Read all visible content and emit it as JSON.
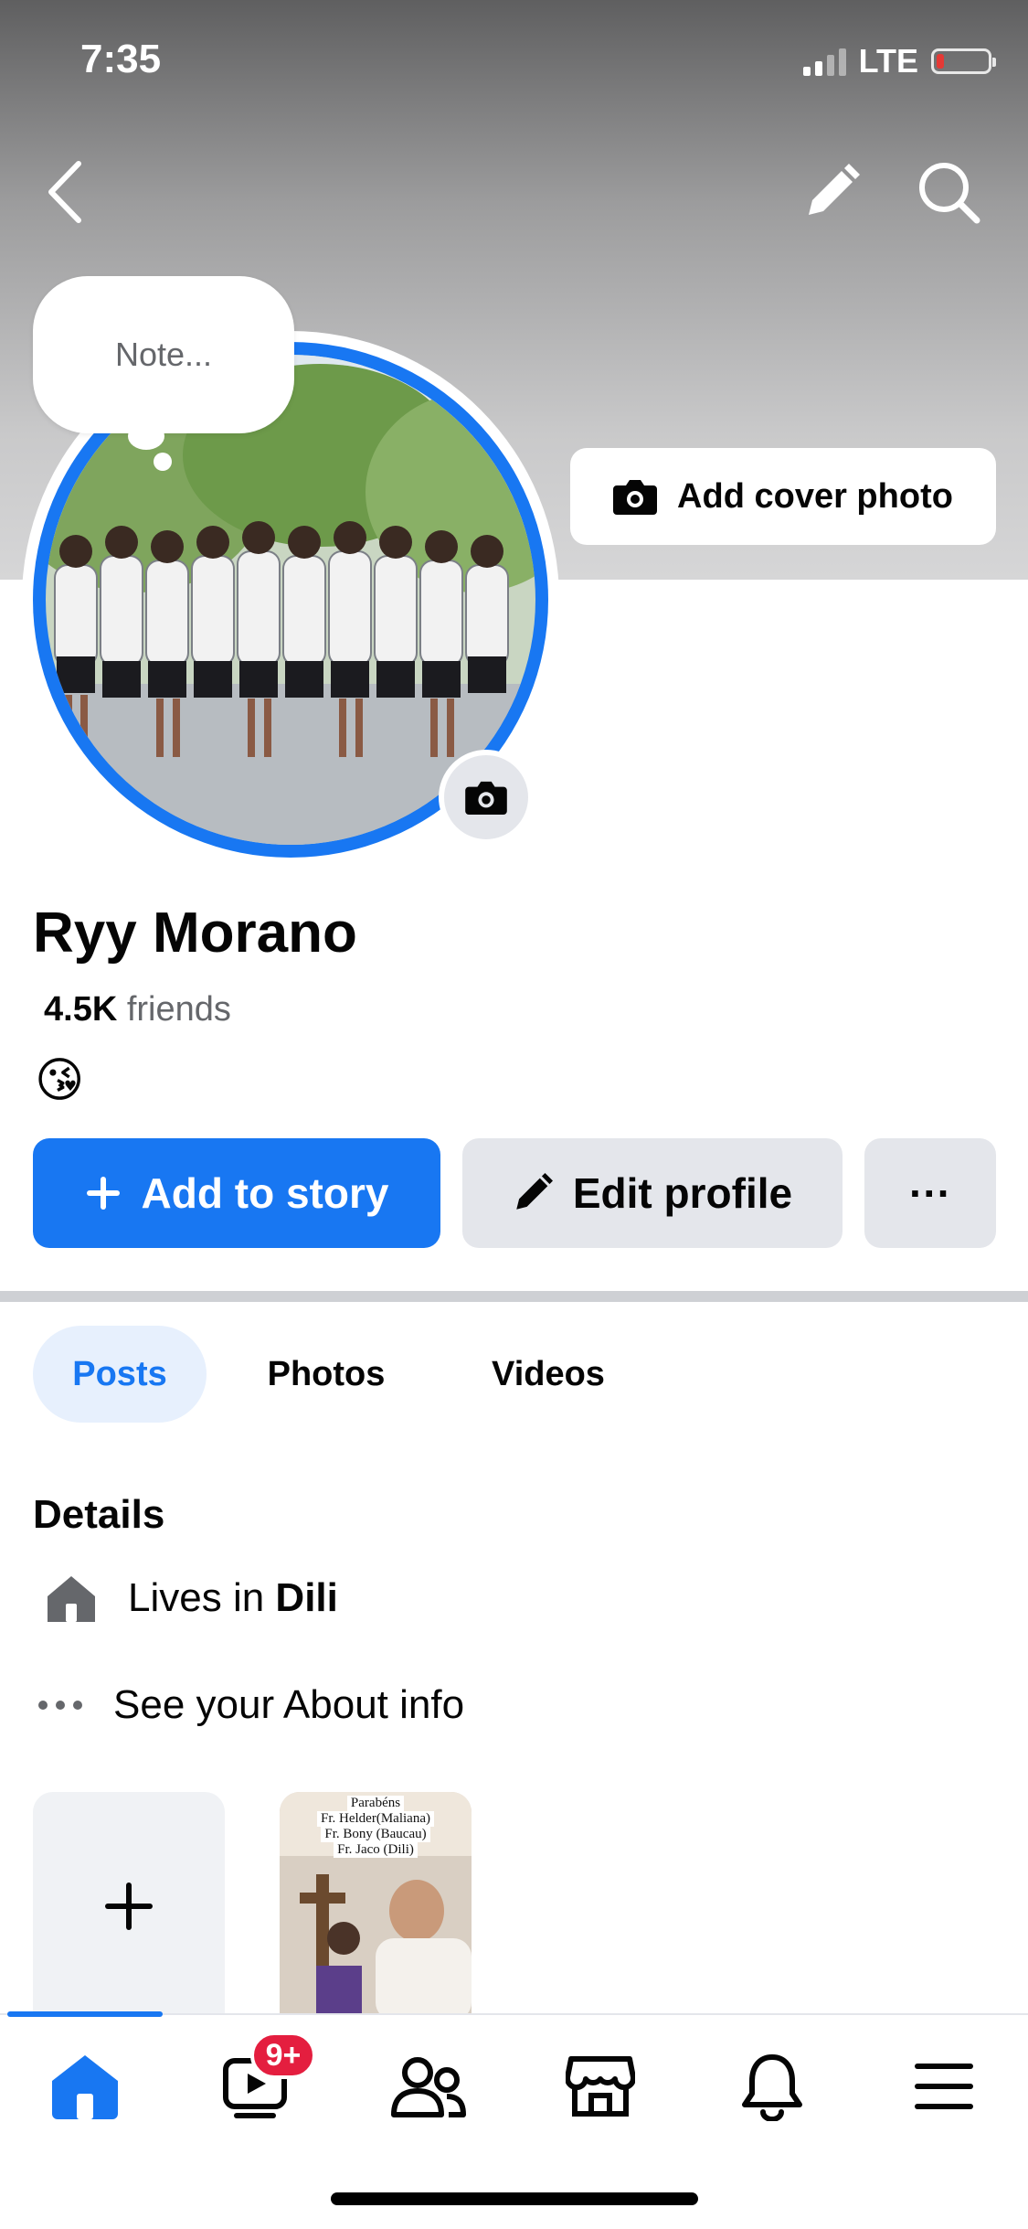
{
  "status_bar": {
    "time": "7:35",
    "network": "LTE",
    "signal_bars": 2,
    "battery_level": 0.1
  },
  "header": {
    "back_icon": "chevron-left-icon",
    "edit_icon": "pencil-icon",
    "search_icon": "search-icon"
  },
  "note_bubble": {
    "text": "Note..."
  },
  "cover": {
    "add_cover_label": "Add cover photo"
  },
  "profile": {
    "name": "Ryy Morano",
    "friends_count": "4.5K",
    "friends_label": "friends",
    "bio_emoji": "😘"
  },
  "actions": {
    "add_story_label": "Add to story",
    "edit_profile_label": "Edit profile",
    "more_label": "···"
  },
  "tabs": [
    {
      "label": "Posts",
      "active": true
    },
    {
      "label": "Photos"
    },
    {
      "label": "Videos"
    }
  ],
  "details": {
    "heading": "Details",
    "lives_prefix": "Lives in ",
    "lives_city": "Dili",
    "about_label": "See your About info"
  },
  "story_thumb": {
    "lines": [
      "Parabéns",
      "Fr. Helder(Maliana)",
      "Fr. Bony (Baucau)",
      "Fr. Jaco (Dili)"
    ]
  },
  "bottom_nav": {
    "items": [
      {
        "name": "home-icon",
        "active": true
      },
      {
        "name": "video-icon",
        "badge": "9+"
      },
      {
        "name": "friends-icon"
      },
      {
        "name": "marketplace-icon"
      },
      {
        "name": "bell-icon"
      },
      {
        "name": "menu-icon"
      }
    ]
  },
  "colors": {
    "accent": "#1877f2",
    "badge": "#e41e3f",
    "button_gray": "#e4e6eb"
  }
}
